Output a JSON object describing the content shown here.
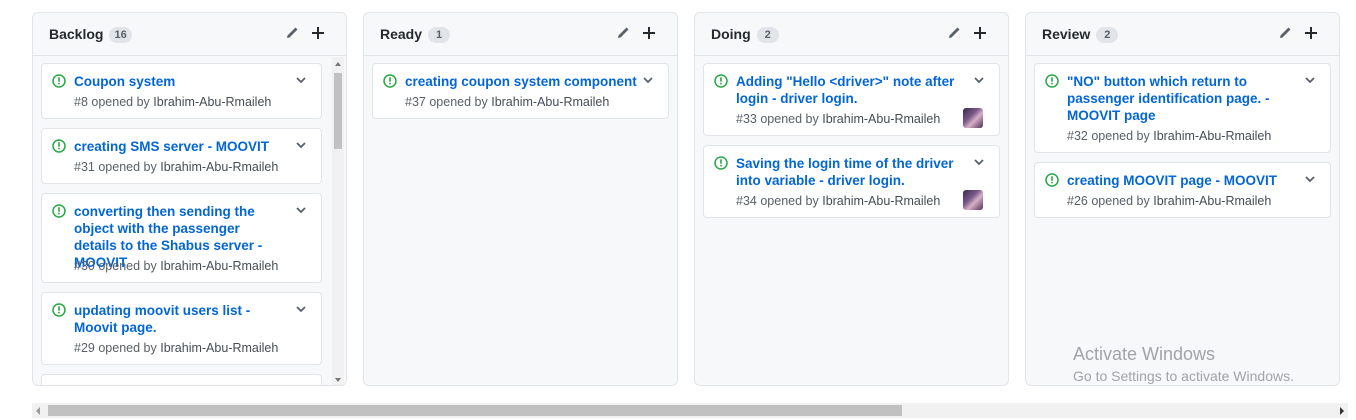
{
  "colors": {
    "link": "#0366d6",
    "open_issue": "#28a745",
    "muted": "#586069"
  },
  "columns": [
    {
      "title": "Backlog",
      "count": "16",
      "cards": [
        {
          "title": "Coupon system",
          "number": "#8",
          "opened_by": "opened by",
          "author": "Ibrahim-Abu-Rmaileh"
        },
        {
          "title": "creating SMS server - MOOVIT",
          "number": "#31",
          "opened_by": "opened by",
          "author": "Ibrahim-Abu-Rmaileh"
        },
        {
          "title": "converting then sending the object with the passenger details to the Shabus server -MOOVIT",
          "number": "#30",
          "opened_by": "opened by",
          "author": "Ibrahim-Abu-Rmaileh"
        },
        {
          "title": "updating moovit users list - Moovit page.",
          "number": "#29",
          "opened_by": "opened by",
          "author": "Ibrahim-Abu-Rmaileh"
        }
      ]
    },
    {
      "title": "Ready",
      "count": "1",
      "cards": [
        {
          "title": "creating coupon system component",
          "number": "#37",
          "opened_by": "opened by",
          "author": "Ibrahim-Abu-Rmaileh"
        }
      ]
    },
    {
      "title": "Doing",
      "count": "2",
      "cards": [
        {
          "title": "Adding \"Hello <driver>\" note after login - driver login.",
          "number": "#33",
          "opened_by": "opened by",
          "author": "Ibrahim-Abu-Rmaileh"
        },
        {
          "title": "Saving the login time of the driver into variable - driver login.",
          "number": "#34",
          "opened_by": "opened by",
          "author": "Ibrahim-Abu-Rmaileh"
        }
      ]
    },
    {
      "title": "Review",
      "count": "2",
      "cards": [
        {
          "title": "\"NO\" button which return to passenger identification page. - MOOVIT page",
          "number": "#32",
          "opened_by": "opened by",
          "author": "Ibrahim-Abu-Rmaileh"
        },
        {
          "title": "creating MOOVIT page - MOOVIT",
          "number": "#26",
          "opened_by": "opened by",
          "author": "Ibrahim-Abu-Rmaileh"
        }
      ]
    }
  ],
  "icons": {
    "column_edit": "pencil-icon",
    "column_add": "plus-icon",
    "issue": "issue-opened-icon",
    "card_menu": "chevron-down-icon"
  },
  "watermark": {
    "title": "Activate Windows",
    "subtitle": "Go to Settings to activate Windows."
  }
}
